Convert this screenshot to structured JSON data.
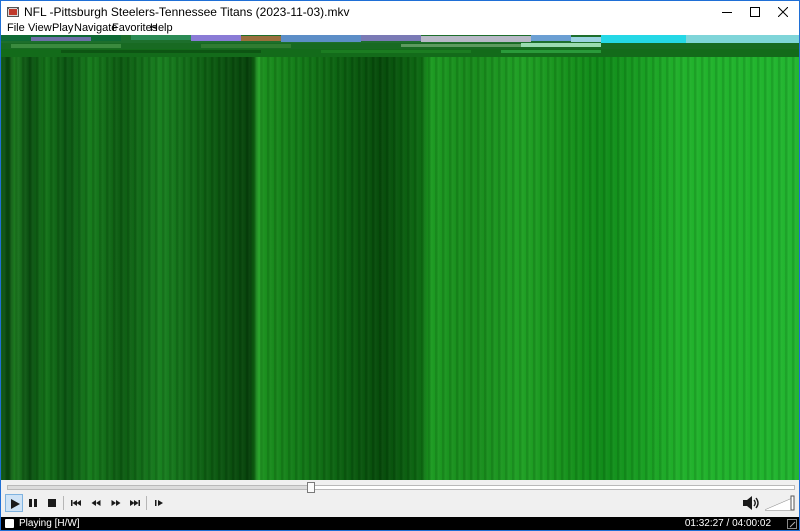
{
  "window": {
    "title": "NFL -Pittsburgh Steelers-Tennessee Titans (2023-11-03).mkv",
    "app_icon": "mpc-film-icon",
    "controls": [
      "minimize-icon",
      "maximize-icon",
      "close-icon"
    ]
  },
  "menu": {
    "items": [
      {
        "label": "File"
      },
      {
        "label": "View"
      },
      {
        "label": "Play"
      },
      {
        "label": "Navigate"
      },
      {
        "label": "Favorites"
      },
      {
        "label": "Help"
      }
    ]
  },
  "player": {
    "seek_progress": 0.385,
    "buttons": [
      "play-icon",
      "pause-icon",
      "stop-icon",
      "skip-back-icon",
      "rewind-icon",
      "fast-forward-icon",
      "skip-forward-icon",
      "frame-step-icon"
    ],
    "active_button": "play-button",
    "volume_icon": "speaker-icon",
    "volume_level": 1.0
  },
  "status": {
    "text": "Playing [H/W]",
    "time": "01:32:27 / 04:00:02"
  },
  "colors": {
    "window_border": "#1f6fd6",
    "video_green": "#1a9a22",
    "status_bg": "#000000"
  }
}
